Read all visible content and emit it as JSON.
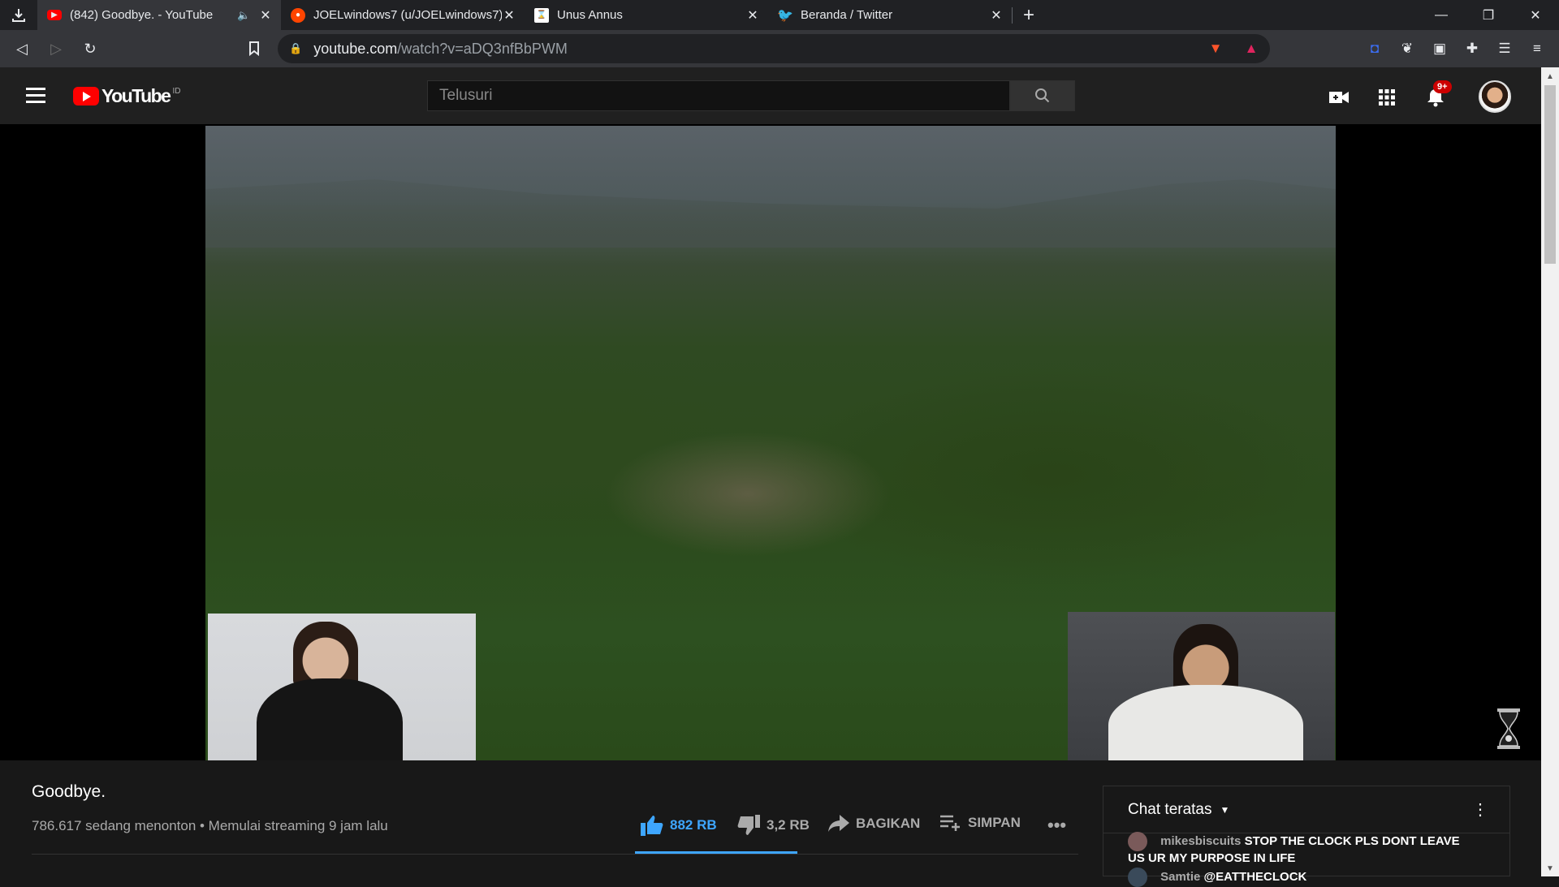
{
  "browser": {
    "tabs": [
      {
        "title": "(842) Goodbye. - YouTube",
        "active": true,
        "favicon": "youtube-icon"
      },
      {
        "title": "JOELwindows7 (u/JOELwindows7) -",
        "active": false,
        "favicon": "reddit-icon"
      },
      {
        "title": "Unus Annus",
        "active": false,
        "favicon": "unus-annus-icon"
      },
      {
        "title": "Beranda / Twitter",
        "active": false,
        "favicon": "twitter-icon"
      }
    ],
    "url_host": "youtube.com",
    "url_path": "/watch?v=aDQ3nfBbPWM"
  },
  "youtube": {
    "logo_text": "YouTube",
    "logo_country": "ID",
    "search_placeholder": "Telusuri",
    "notification_badge": "9+"
  },
  "video": {
    "title": "Goodbye.",
    "meta": "786.617 sedang menonton • Memulai streaming 9 jam lalu",
    "likes": "882 RB",
    "dislikes": "3,2 RB",
    "share_label": "BAGIKAN",
    "save_label": "SIMPAN"
  },
  "chat": {
    "header": "Chat teratas",
    "messages": [
      {
        "author": "mikesbiscuits",
        "text": "STOP THE CLOCK PLS DONT LEAVE US UR MY PURPOSE IN LIFE"
      },
      {
        "author": "Samtie",
        "text": "@EATTHECLOCK"
      }
    ]
  },
  "colors": {
    "accent": "#3ea6ff",
    "brand_red": "#ff0000"
  }
}
